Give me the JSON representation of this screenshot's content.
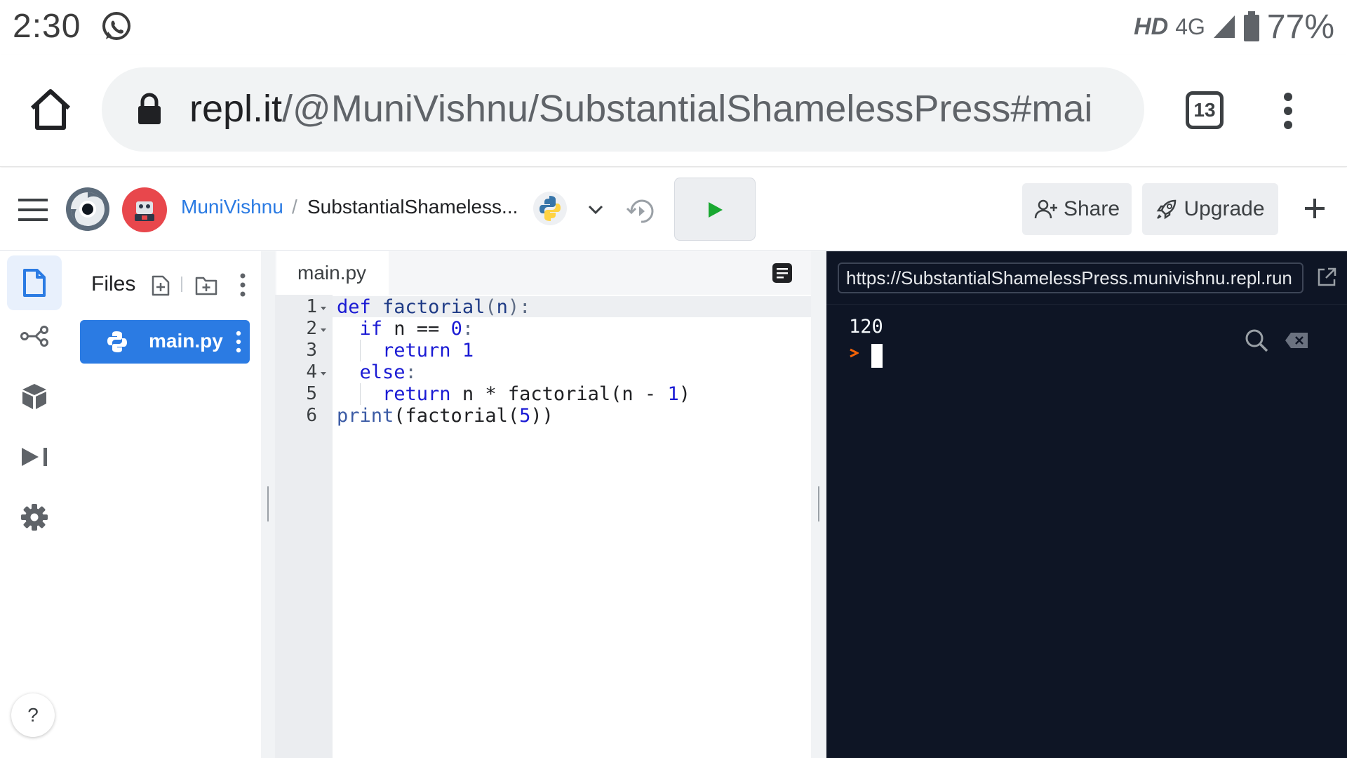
{
  "status_bar": {
    "time": "2:30",
    "network_hd": "HD",
    "network_type": "4G",
    "battery_percent": "77%"
  },
  "browser": {
    "url_domain": "repl.it",
    "url_path": "/@MuniVishnu/SubstantialShamelessPress#mai",
    "tab_count": "13"
  },
  "header": {
    "username": "MuniVishnu",
    "separator": "/",
    "repl_name": "SubstantialShameless...",
    "share_label": "Share",
    "upgrade_label": "Upgrade"
  },
  "files_panel": {
    "title": "Files",
    "files": [
      {
        "name": "main.py"
      }
    ]
  },
  "editor": {
    "tab_label": "main.py",
    "line_numbers": [
      "1",
      "2",
      "3",
      "4",
      "5",
      "6"
    ]
  },
  "console": {
    "webview_url": "https://SubstantialShamelessPress.munivishnu.repl.run",
    "output": "120"
  },
  "help": {
    "label": "?"
  },
  "colors": {
    "accent": "#2b7be3",
    "console_bg": "#0e1525",
    "run_green": "#19a831",
    "avatar_red": "#e8474c"
  }
}
